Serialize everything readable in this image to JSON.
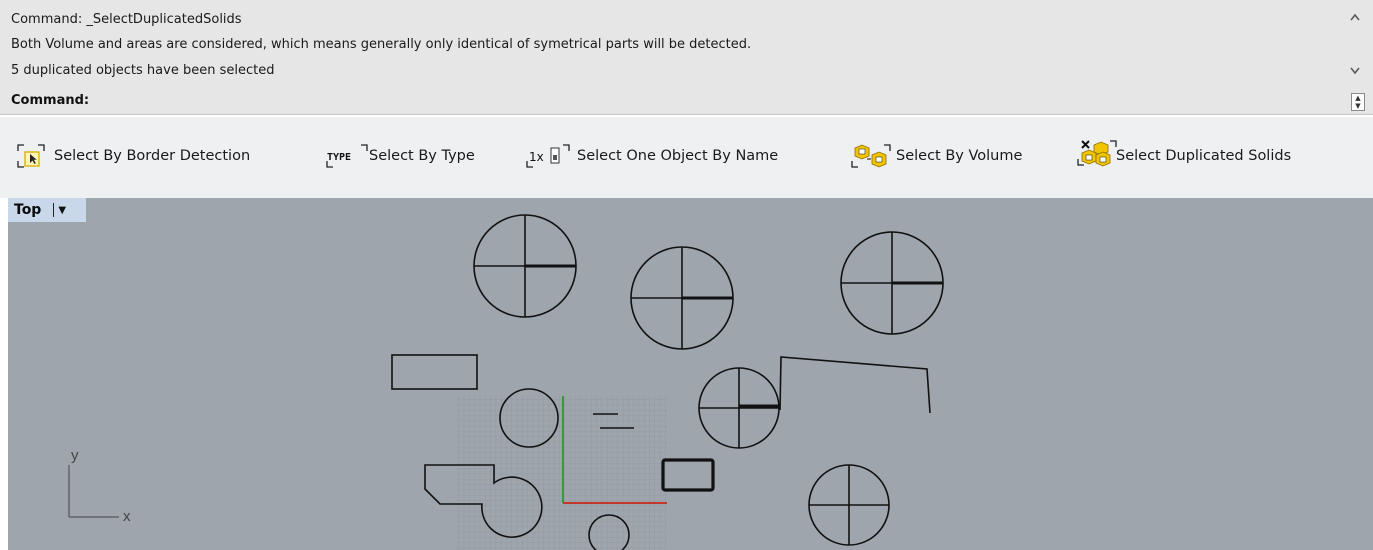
{
  "history": {
    "lines": [
      "Command: _SelectDuplicatedSolids",
      "Both Volume and areas are considered, which means generally only identical of symetrical parts will be detected.",
      "5 duplicated objects have been selected"
    ],
    "scroll_up": "^",
    "scroll_down": "⌄"
  },
  "prompt": {
    "label": "Command:"
  },
  "toolbar": {
    "items": [
      {
        "label": "Select By Border Detection",
        "icon": "border-detection-icon"
      },
      {
        "label": "Select By Type",
        "icon": "type-icon",
        "icon_text": "TYPE"
      },
      {
        "label": "Select One Object By Name",
        "icon": "name-icon",
        "icon_text": "1x"
      },
      {
        "label": "Select By Volume",
        "icon": "volume-icon"
      },
      {
        "label": "Select Duplicated Solids",
        "icon": "duplicated-solids-icon"
      }
    ]
  },
  "viewport": {
    "title": "Top",
    "axis_y": "y",
    "axis_x": "x",
    "background": "#9ea5ad",
    "grid_color": "#8c9299",
    "x_axis_color": "#c0392b",
    "y_axis_color": "#3a9a3a"
  }
}
